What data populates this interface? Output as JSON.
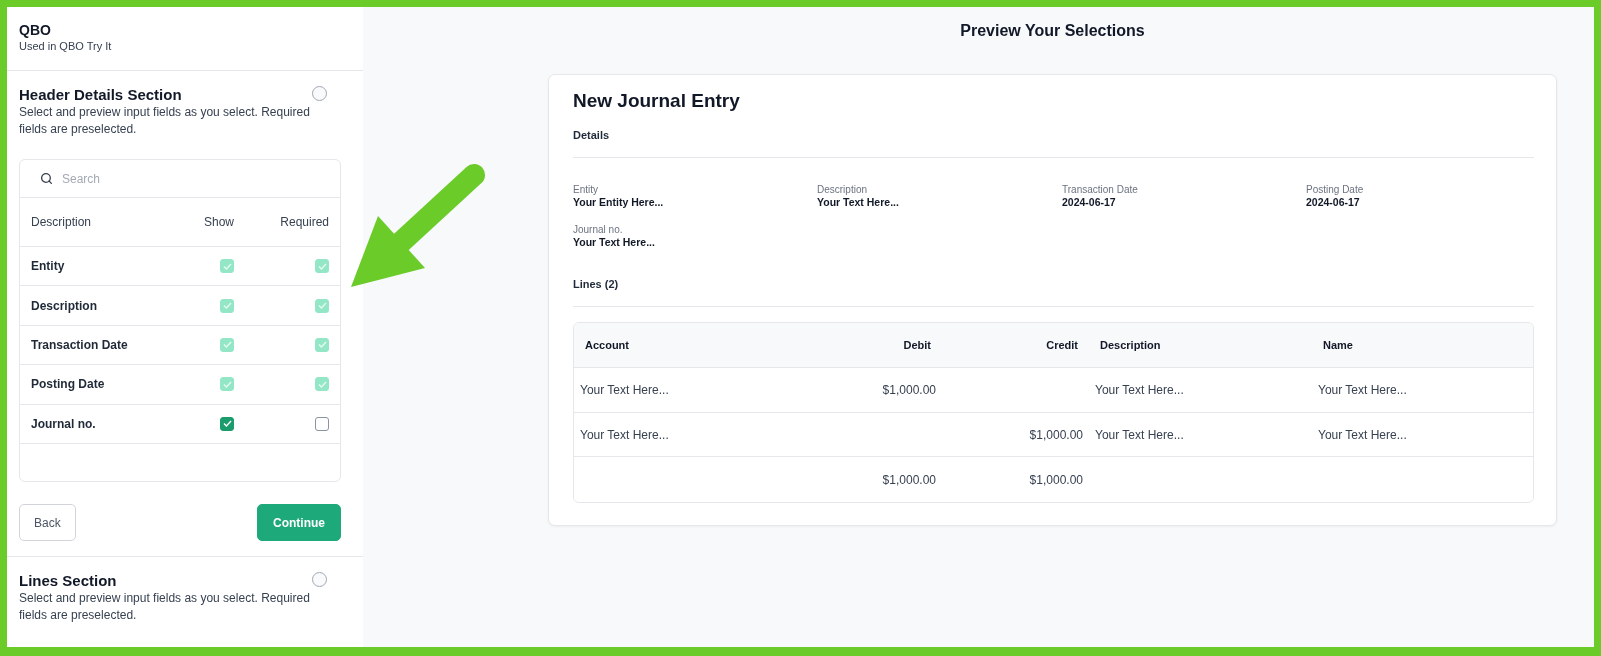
{
  "sidebar": {
    "header": {
      "title": "QBO",
      "subtitle": "Used in QBO Try It"
    },
    "sections": [
      {
        "title": "Header Details Section",
        "description": "Select and preview input fields as you select. Required fields are preselected.",
        "selected": false,
        "search": {
          "placeholder": "Search"
        },
        "columns": [
          "Description",
          "Show",
          "Required"
        ],
        "fields": [
          {
            "name": "Entity",
            "show": {
              "checked": true,
              "disabled": true
            },
            "required": {
              "checked": true,
              "disabled": true
            }
          },
          {
            "name": "Description",
            "show": {
              "checked": true,
              "disabled": true
            },
            "required": {
              "checked": true,
              "disabled": true
            }
          },
          {
            "name": "Transaction Date",
            "show": {
              "checked": true,
              "disabled": true
            },
            "required": {
              "checked": true,
              "disabled": true
            }
          },
          {
            "name": "Posting Date",
            "show": {
              "checked": true,
              "disabled": true
            },
            "required": {
              "checked": true,
              "disabled": true
            }
          },
          {
            "name": "Journal no.",
            "show": {
              "checked": true,
              "disabled": false
            },
            "required": {
              "checked": false,
              "disabled": false
            }
          }
        ],
        "buttons": [
          {
            "label": "Back",
            "kind": "secondary"
          },
          {
            "label": "Continue",
            "kind": "primary"
          }
        ]
      },
      {
        "title": "Lines Section",
        "description": "Select and preview input fields as you select. Required fields are preselected.",
        "selected": false
      }
    ]
  },
  "preview": {
    "heading": "Preview Your Selections",
    "card": {
      "title": "New Journal Entry",
      "details_label": "Details",
      "details": [
        {
          "label": "Entity",
          "value": "Your Entity Here..."
        },
        {
          "label": "Description",
          "value": "Your Text Here..."
        },
        {
          "label": "Transaction Date",
          "value": "2024-06-17"
        },
        {
          "label": "Posting Date",
          "value": "2024-06-17"
        },
        {
          "label": "Journal no.",
          "value": "Your Text Here..."
        }
      ],
      "lines_label": "Lines (2)",
      "lines": {
        "columns": [
          {
            "label": "Account",
            "kind": "text"
          },
          {
            "label": "Debit",
            "kind": "amount"
          },
          {
            "label": "Credit",
            "kind": "amount"
          },
          {
            "label": "Description",
            "kind": "text"
          },
          {
            "label": "Name",
            "kind": "text"
          }
        ],
        "rows": [
          [
            "Your Text Here...",
            "$1,000.00",
            null,
            "Your Text Here...",
            "Your Text Here..."
          ],
          [
            "Your Text Here...",
            null,
            "$1,000.00",
            "Your Text Here...",
            "Your Text Here..."
          ],
          [
            null,
            "$1,000.00",
            "$1,000.00",
            null,
            null
          ]
        ]
      }
    }
  }
}
